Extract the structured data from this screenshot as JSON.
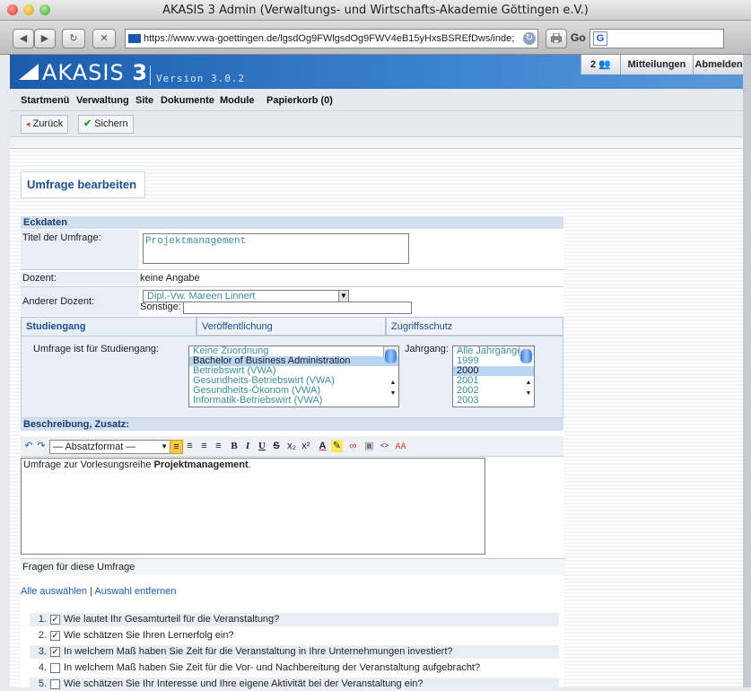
{
  "window": {
    "title": "AKASIS 3 Admin (Verwaltungs- und Wirtschafts-Akademie Göttingen e.V.)"
  },
  "browser": {
    "back_label": "◀",
    "forward_label": "▶",
    "reload_label": "↻",
    "stop_label": "✕",
    "url": "https://www.vwa-goettingen.de/lgsdOg9FWlgsdOg9FWV4eB15yHxsBSREfDws/inde;",
    "go_label": "Go",
    "search_icon": "G",
    "print_icon": "print-icon"
  },
  "header": {
    "logo_text": "AKASIS",
    "logo_number": "3",
    "version": "Version 3.0.2",
    "users_count": "2",
    "messages_label": "Mitteilungen",
    "logout_label": "Abmelden"
  },
  "menu": {
    "items": [
      "Startmenü",
      "Verwaltung",
      "Site",
      "Dokumente",
      "Module",
      "Papierkorb (0)"
    ]
  },
  "actions": {
    "back_label": "Zurück",
    "save_label": "Sichern"
  },
  "page": {
    "title": "Umfrage bearbeiten"
  },
  "eckdaten": {
    "heading": "Eckdaten",
    "titel_label": "Titel der Umfrage:",
    "titel_value": "Projektmanagement",
    "dozent_label": "Dozent:",
    "dozent_value": "keine Angabe",
    "anderer_label": "Anderer Dozent:",
    "anderer_value": "Dipl.-Vw. Mareen Linnert",
    "sonstige_label": "Sonstige:",
    "sonstige_value": ""
  },
  "tabs": [
    "Studiengang",
    "Veröffentlichung",
    "Zugriffsschutz"
  ],
  "studiengang": {
    "label": "Umfrage ist für Studiengang:",
    "options": [
      "Keine Zuordnung",
      "Bachelor of Business Administration",
      "Betriebswirt (VWA)",
      "Gesundheits-Betriebswirt (VWA)",
      "Gesundheits-Ökonom (VWA)",
      "Informatik-Betriebswirt (VWA)"
    ],
    "selected": "Bachelor of Business Administration",
    "jahrgang_label": "Jahrgang:",
    "jahrgang_options": [
      "Alle Jahrgänge",
      "1999",
      "2000",
      "2001",
      "2002",
      "2003"
    ],
    "jahrgang_selected": "2000"
  },
  "beschreibung": {
    "heading": "Beschreibung, Zusatz:",
    "format_label": "— Absatzformat —",
    "text_plain": "Umfrage zur Vorlesungsreihe ",
    "text_bold": "Projektmanagement",
    "text_end": "."
  },
  "fragen": {
    "heading": "Fragen für diese Umfrage",
    "select_all": "Alle auswählen",
    "separator": "|",
    "deselect": "Auswahl entfernen",
    "items": [
      {
        "num": "1.",
        "checked": true,
        "text": "Wie lautet Ihr Gesamturteil für die Veranstaltung?"
      },
      {
        "num": "2.",
        "checked": true,
        "text": "Wie schätzen Sie Ihren Lernerfolg ein?"
      },
      {
        "num": "3.",
        "checked": true,
        "text": "In welchem Maß haben Sie Zeit für die Veranstaltung in Ihre Unternehmungen investiert?"
      },
      {
        "num": "4.",
        "checked": false,
        "text": "In welchem Maß haben Sie Zeit für die Vor- und Nachbereitung der Veranstaltung aufgebracht?"
      },
      {
        "num": "5.",
        "checked": false,
        "text": "Wie schätzen Sie Ihr Interesse und Ihre eigene Aktivität bei der Veranstaltung ein?"
      }
    ]
  },
  "colors": {
    "brand": "#1c5cab",
    "section_bg": "#d5e0ee",
    "link": "#1e5aa8",
    "selection": "#b7d4f2"
  }
}
